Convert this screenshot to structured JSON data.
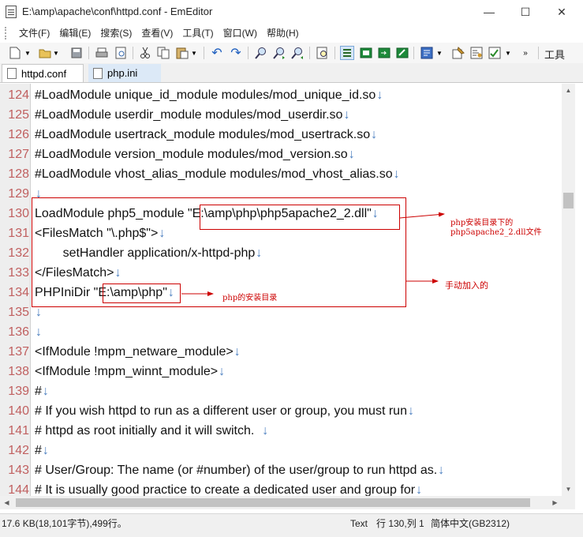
{
  "window": {
    "title": "E:\\amp\\apache\\conf\\httpd.conf - EmEditor",
    "minimize": "—",
    "maximize": "☐",
    "close": "✕"
  },
  "menu": [
    {
      "label": "文件(F)"
    },
    {
      "label": "编辑(E)"
    },
    {
      "label": "搜索(S)"
    },
    {
      "label": "查看(V)"
    },
    {
      "label": "工具(T)"
    },
    {
      "label": "窗口(W)"
    },
    {
      "label": "帮助(H)"
    }
  ],
  "toolbar": {
    "tools_label": "工具",
    "more": "»"
  },
  "tabs": [
    {
      "label": "httpd.conf",
      "active": true
    },
    {
      "label": "php.ini",
      "active": false
    }
  ],
  "editor": {
    "eol_mark": "↓",
    "lines": [
      {
        "num": "124",
        "text": "#LoadModule unique_id_module modules/mod_unique_id.so"
      },
      {
        "num": "125",
        "text": "#LoadModule userdir_module modules/mod_userdir.so"
      },
      {
        "num": "126",
        "text": "#LoadModule usertrack_module modules/mod_usertrack.so"
      },
      {
        "num": "127",
        "text": "#LoadModule version_module modules/mod_version.so"
      },
      {
        "num": "128",
        "text": "#LoadModule vhost_alias_module modules/mod_vhost_alias.so"
      },
      {
        "num": "129",
        "text": ""
      },
      {
        "num": "130",
        "text": "LoadModule php5_module \"E:\\amp\\php\\php5apache2_2.dll\""
      },
      {
        "num": "131",
        "text": "<FilesMatch \"\\.php$\">"
      },
      {
        "num": "132",
        "text": "        setHandler application/x-httpd-php"
      },
      {
        "num": "133",
        "text": "</FilesMatch>"
      },
      {
        "num": "134",
        "text": "PHPIniDir \"E:\\amp\\php\""
      },
      {
        "num": "135",
        "text": ""
      },
      {
        "num": "136",
        "text": ""
      },
      {
        "num": "137",
        "text": "<IfModule !mpm_netware_module>"
      },
      {
        "num": "138",
        "text": "<IfModule !mpm_winnt_module>"
      },
      {
        "num": "139",
        "text": "#"
      },
      {
        "num": "140",
        "text": "# If you wish httpd to run as a different user or group, you must run"
      },
      {
        "num": "141",
        "text": "# httpd as root initially and it will switch.  "
      },
      {
        "num": "142",
        "text": "#"
      },
      {
        "num": "143",
        "text": "# User/Group: The name (or #number) of the user/group to run httpd as."
      },
      {
        "num": "144",
        "text": "# It is usually good practice to create a dedicated user and group for"
      }
    ]
  },
  "annotations": {
    "dll_note": "php安装目录下的\nphp5apache2_2.dll文件",
    "manual_note": "手动加入的",
    "dir_note": "php的安装目录",
    "color": "#cc0000"
  },
  "status": {
    "size": "17.6 KB(18,101字节),499行。",
    "mode": "Text",
    "position": "行 130,列 1",
    "encoding": "简体中文(GB2312)"
  }
}
